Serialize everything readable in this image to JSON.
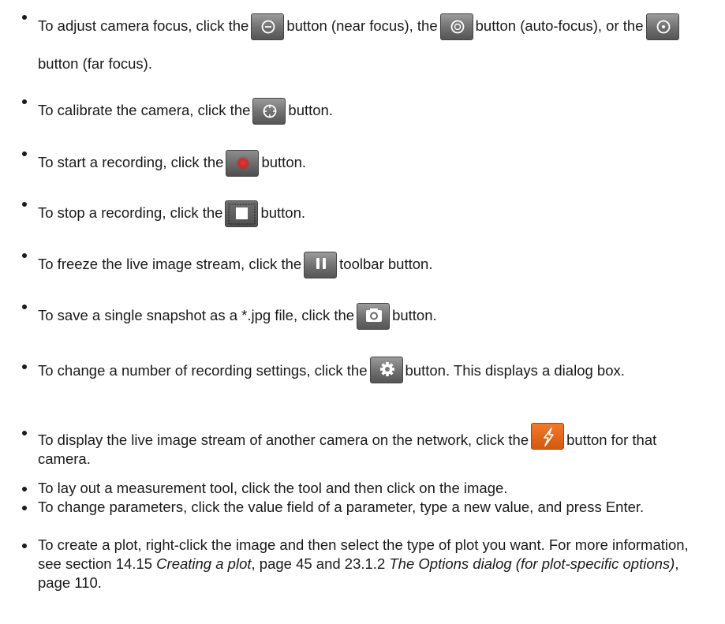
{
  "items": [
    {
      "a": "To adjust camera focus, click the",
      "b": "button (near focus), the",
      "c": "button (auto-focus), or the",
      "d": "button (far focus)."
    },
    {
      "a": "To calibrate the camera, click the",
      "b": "button."
    },
    {
      "a": "To start a recording, click the",
      "b": "button."
    },
    {
      "a": "To stop a recording, click the",
      "b": "button."
    },
    {
      "a": "To freeze the live image stream, click the",
      "b": "toolbar button."
    },
    {
      "a": "To save a single snapshot as a *.jpg file, click the",
      "b": "button."
    },
    {
      "a": "To change a number of recording settings, click the",
      "b": "button. This displays a dialog box."
    },
    {
      "a": "To display the live image stream of another camera on the network, click the",
      "b": "button for that camera."
    },
    {
      "a": "To lay out a measurement tool, click the tool and then click on the image."
    },
    {
      "a": "To change parameters, click the value field of a parameter, type a new value, and press Enter."
    },
    {
      "a": "To create a plot, right-click the image and then select the type of plot you want. For more information, see section 14.15",
      "b": "Creating a plot",
      "c": ", page 45 and 23.1.2",
      "d": "The Options dialog (for plot-specific options)",
      "e": ", page 110."
    }
  ],
  "icons": [
    "near-focus",
    "auto-focus",
    "far-focus",
    "calibrate",
    "record",
    "stop",
    "pause",
    "snapshot-camera",
    "settings-gear",
    "lightning"
  ],
  "colors": {
    "record_dot": "#d42020",
    "stream_button": "#e8691f"
  }
}
